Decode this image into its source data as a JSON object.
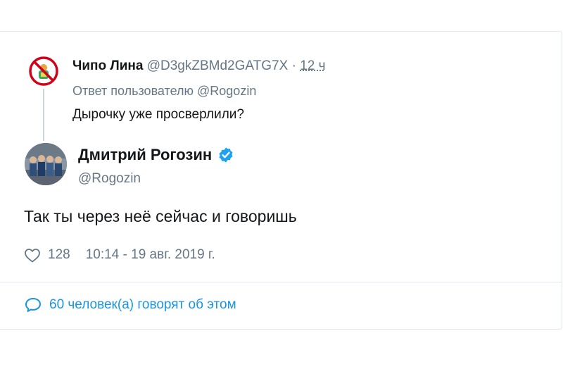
{
  "reply": {
    "name": "Чипо Лина",
    "handle": "@D3gkZBMd2GATG7X",
    "dot": " · ",
    "time": "12 ч",
    "reply_to_prefix": "Ответ пользователю ",
    "reply_to_handle": "@Rogozin",
    "text": "Дырочку уже просверлили?"
  },
  "tweet": {
    "name": "Дмитрий Рогозин",
    "handle": "@Rogozin",
    "text": "Так ты через неё сейчас и говоришь",
    "likes": "128",
    "timestamp": "10:14 - 19 авг. 2019 г."
  },
  "conversation": {
    "label": "60 человек(а) говорят об этом"
  },
  "icons": {
    "verified": "verified-badge-icon",
    "like": "heart-icon",
    "reply": "speech-bubble-icon"
  },
  "colors": {
    "link_blue": "#1b95e0",
    "verified_blue": "#1da1f2",
    "secondary_gray": "#657786",
    "primary_text": "#14171a",
    "border": "#e1e8ed"
  }
}
